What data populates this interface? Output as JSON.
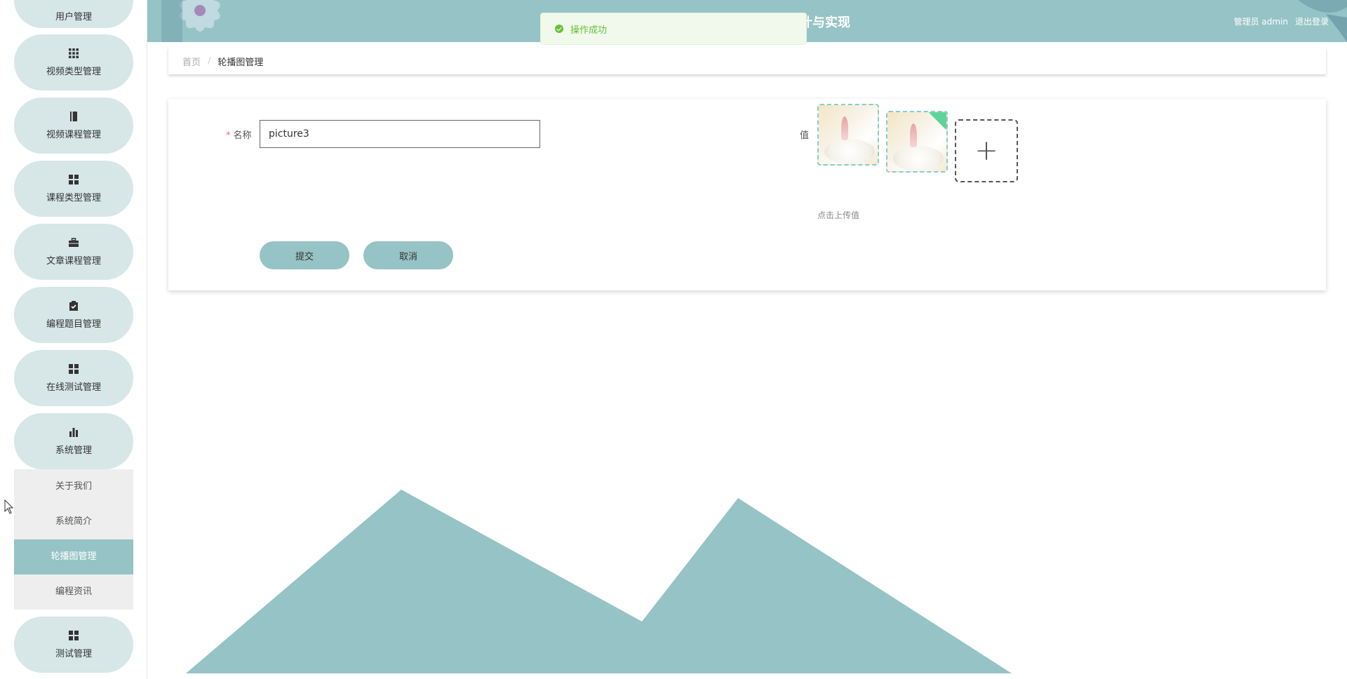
{
  "colors": {
    "accent": "#96c3c5",
    "pill_bg": "#d7e6e7",
    "success": "#67c23a",
    "required": "#f56c6c"
  },
  "header": {
    "title_partial": "计与实现",
    "user_label": "管理员 admin",
    "logout": "退出登录"
  },
  "toast": {
    "message": "操作成功",
    "icon": "success-check-icon"
  },
  "sidebar": {
    "items": [
      {
        "label": "用户管理",
        "icon": "user-icon"
      },
      {
        "label": "视频类型管理",
        "icon": "grid-icon"
      },
      {
        "label": "视频课程管理",
        "icon": "book-icon"
      },
      {
        "label": "课程类型管理",
        "icon": "apps-icon"
      },
      {
        "label": "文章课程管理",
        "icon": "briefcase-icon"
      },
      {
        "label": "编程题目管理",
        "icon": "clipboard-check-icon"
      },
      {
        "label": "在线测试管理",
        "icon": "apps-icon"
      },
      {
        "label": "系统管理",
        "icon": "bar-chart-icon"
      },
      {
        "label": "测试管理",
        "icon": "apps-icon"
      }
    ],
    "submenu": [
      {
        "label": "关于我们"
      },
      {
        "label": "系统简介"
      },
      {
        "label": "轮播图管理",
        "active": true
      },
      {
        "label": "编程资讯"
      }
    ]
  },
  "breadcrumb": {
    "home": "首页",
    "separator": "/",
    "current": "轮播图管理"
  },
  "form": {
    "name_label": "名称",
    "name_value": "picture3",
    "value_label": "值",
    "upload_tip": "点击上传值",
    "upload_icon": "plus-icon",
    "submit": "提交",
    "cancel": "取消"
  }
}
